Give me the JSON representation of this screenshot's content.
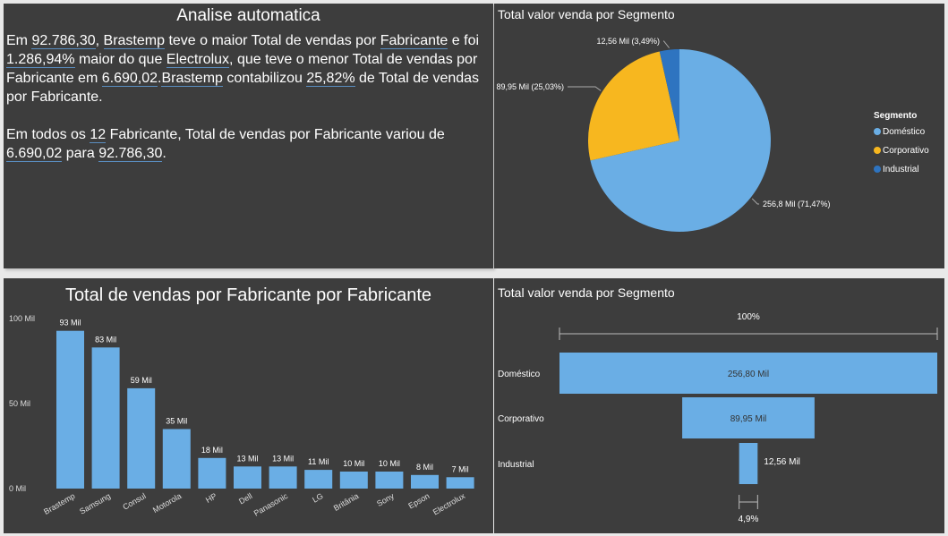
{
  "analysis": {
    "title": "Analise automatica",
    "p1": [
      {
        "t": "Em "
      },
      {
        "t": "92.786,30",
        "hl": true
      },
      {
        "t": ", "
      },
      {
        "t": "Brastemp",
        "hl": true
      },
      {
        "t": " teve o maior Total de vendas por "
      },
      {
        "t": "Fabricante",
        "hl": true
      },
      {
        "t": " e foi "
      },
      {
        "t": "1.286,94%",
        "hl": true
      },
      {
        "t": " maior do que "
      },
      {
        "t": "Electrolux",
        "hl": true
      },
      {
        "t": ", que teve o menor Total de vendas por Fabricante em "
      },
      {
        "t": "6.690,02",
        "hl": true
      },
      {
        "t": "."
      },
      {
        "t": "Brastemp",
        "hl": true
      },
      {
        "t": " contabilizou "
      },
      {
        "t": "25,82%",
        "hl": true
      },
      {
        "t": " de Total de vendas por Fabricante."
      }
    ],
    "p2": [
      {
        "t": "Em todos os "
      },
      {
        "t": "12",
        "hl": true
      },
      {
        "t": " Fabricante, Total de vendas por Fabricante variou de "
      },
      {
        "t": "6.690,02",
        "hl": true
      },
      {
        "t": " para "
      },
      {
        "t": "92.786,30",
        "hl": true
      },
      {
        "t": "."
      }
    ]
  },
  "pie": {
    "title": "Total valor venda por Segmento",
    "legend_title": "Segmento",
    "legend_position": "right",
    "slices": [
      {
        "name": "Doméstico",
        "value": 256.8,
        "label": "256,8 Mil (71,47%)",
        "color": "#6aaee5"
      },
      {
        "name": "Corporativo",
        "value": 89.95,
        "label": "89,95 Mil (25,03%)",
        "color": "#f7b71f"
      },
      {
        "name": "Industrial",
        "value": 12.56,
        "label": "12,56 Mil (3,49%)",
        "color": "#2e74c0"
      }
    ]
  },
  "bars": {
    "title": "Total de vendas por Fabricante por Fabricante",
    "bar_color": "#6aaee5",
    "y_ticks": [
      {
        "v": 0,
        "label": "0 Mil"
      },
      {
        "v": 50,
        "label": "50 Mil"
      },
      {
        "v": 100,
        "label": "100 Mil"
      }
    ]
  },
  "funnel": {
    "title": "Total valor venda por Segmento",
    "top_pct": "100%",
    "bottom_pct": "4,9%",
    "color": "#6aaee5",
    "stages": [
      {
        "name": "Doméstico",
        "value": 256.8,
        "label": "256,80 Mil"
      },
      {
        "name": "Corporativo",
        "value": 89.95,
        "label": "89,95 Mil"
      },
      {
        "name": "Industrial",
        "value": 12.56,
        "label": "12,56 Mil"
      }
    ]
  },
  "chart_data": [
    {
      "type": "bar",
      "title": "Total de vendas por Fabricante por Fabricante",
      "categories": [
        "Brastemp",
        "Samsung",
        "Consul",
        "Motorola",
        "HP",
        "Dell",
        "Panasonic",
        "LG",
        "Britânia",
        "Sony",
        "Epson",
        "Electrolux"
      ],
      "values": [
        92.79,
        83,
        59,
        35,
        18,
        13,
        13,
        11,
        10,
        10,
        8,
        6.69
      ],
      "data_labels": [
        "93 Mil",
        "83 Mil",
        "59 Mil",
        "35 Mil",
        "18 Mil",
        "13 Mil",
        "13 Mil",
        "11 Mil",
        "10 Mil",
        "10 Mil",
        "8 Mil",
        "7 Mil"
      ],
      "ylim": [
        0,
        100
      ],
      "grid": false
    },
    {
      "type": "pie",
      "title": "Total valor venda por Segmento",
      "categories": [
        "Doméstico",
        "Corporativo",
        "Industrial"
      ],
      "values": [
        256.8,
        89.95,
        12.56
      ]
    },
    {
      "type": "bar",
      "title": "Total valor venda por Segmento",
      "categories": [
        "Doméstico",
        "Corporativo",
        "Industrial"
      ],
      "values": [
        256.8,
        89.95,
        12.56
      ]
    }
  ]
}
